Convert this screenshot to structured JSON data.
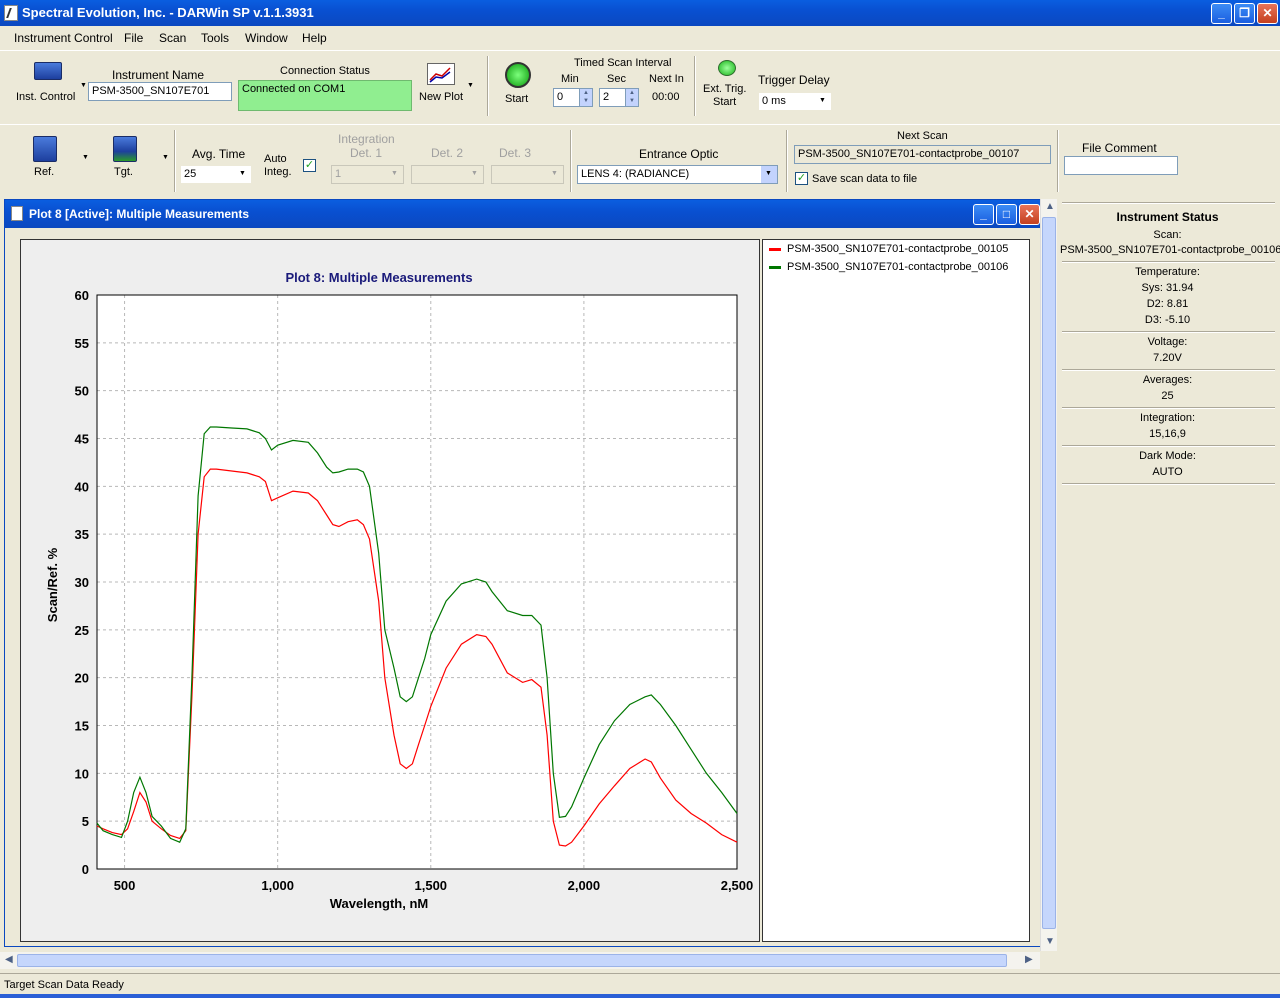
{
  "window": {
    "title": "Spectral Evolution, Inc. - DARWin SP v.1.1.3931"
  },
  "menu": [
    "Instrument Control",
    "File",
    "Scan",
    "Tools",
    "Window",
    "Help"
  ],
  "toolbar1": {
    "inst_control_label": "Inst. Control",
    "instrument_name_label": "Instrument Name",
    "instrument_name_value": "PSM-3500_SN107E701",
    "connection_status_label": "Connection Status",
    "connection_status_value": "Connected on COM1",
    "new_plot_label": "New Plot",
    "start_label": "Start",
    "timed_scan_label": "Timed Scan Interval",
    "min_label": "Min",
    "sec_label": "Sec",
    "next_in_label": "Next In",
    "min_value": "0",
    "sec_value": "2",
    "next_in_value": "00:00",
    "ext_trig_label": "Ext. Trig.",
    "ext_trig_start_label": "Start",
    "trigger_delay_label": "Trigger Delay",
    "trigger_delay_value": "0 ms"
  },
  "toolbar2": {
    "ref_label": "Ref.",
    "tgt_label": "Tgt.",
    "avg_time_label": "Avg. Time",
    "avg_time_value": "25",
    "auto_integ_label_1": "Auto",
    "auto_integ_label_2": "Integ.",
    "integration_label": "Integration",
    "det1_label": "Det. 1",
    "det1_value": "1",
    "det2_label": "Det. 2",
    "det3_label": "Det. 3",
    "entrance_optic_label": "Entrance Optic",
    "entrance_optic_value": "LENS 4: (RADIANCE)",
    "next_scan_label": "Next Scan",
    "next_scan_value": "PSM-3500_SN107E701-contactprobe_00107",
    "save_scan_label": "Save scan data to file",
    "file_comment_label": "File Comment",
    "file_comment_value": ""
  },
  "plot_window": {
    "title": "Plot 8 [Active]: Multiple Measurements"
  },
  "legend": [
    {
      "name": "PSM-3500_SN107E701-contactprobe_00105",
      "color": "#ff0000"
    },
    {
      "name": "PSM-3500_SN107E701-contactprobe_00106",
      "color": "#007700"
    }
  ],
  "chart_data": {
    "type": "line",
    "title": "Plot 8: Multiple Measurements",
    "xlabel": "Wavelength, nM",
    "ylabel": "Scan/Ref. %",
    "xlim": [
      410,
      2500
    ],
    "ylim": [
      0,
      60
    ],
    "x_ticks": [
      500,
      1000,
      1500,
      2000,
      2500
    ],
    "x_tick_labels": [
      "500",
      "1,000",
      "1,500",
      "2,000",
      "2,500"
    ],
    "y_ticks": [
      0,
      5,
      10,
      15,
      20,
      25,
      30,
      35,
      40,
      45,
      50,
      55,
      60
    ],
    "grid": true,
    "series": [
      {
        "name": "PSM-3500_SN107E701-contactprobe_00105",
        "color": "#ff0000",
        "x": [
          410,
          430,
          460,
          490,
          510,
          530,
          550,
          570,
          590,
          620,
          650,
          680,
          700,
          720,
          740,
          760,
          780,
          800,
          850,
          900,
          940,
          960,
          980,
          1000,
          1050,
          1100,
          1130,
          1160,
          1180,
          1200,
          1230,
          1260,
          1280,
          1300,
          1330,
          1350,
          1380,
          1400,
          1420,
          1440,
          1460,
          1480,
          1500,
          1550,
          1600,
          1650,
          1680,
          1700,
          1750,
          1800,
          1830,
          1860,
          1880,
          1900,
          1920,
          1940,
          1960,
          2000,
          2050,
          2100,
          2150,
          2200,
          2220,
          2250,
          2300,
          2350,
          2400,
          2450,
          2500
        ],
        "y": [
          4.5,
          4.2,
          3.8,
          3.6,
          4.2,
          6.0,
          8.0,
          7.0,
          5.0,
          4.2,
          3.5,
          3.2,
          4.0,
          18,
          35,
          41,
          41.8,
          41.8,
          41.6,
          41.4,
          41.0,
          40.5,
          38.5,
          38.8,
          39.5,
          39.3,
          38.5,
          37.0,
          36.0,
          35.8,
          36.3,
          36.5,
          36.0,
          34.5,
          28.0,
          20.0,
          14.0,
          11.0,
          10.5,
          11.0,
          13.0,
          15.0,
          17.0,
          21.0,
          23.5,
          24.5,
          24.3,
          23.5,
          20.5,
          19.5,
          19.8,
          19.0,
          14.0,
          5.0,
          2.5,
          2.4,
          2.8,
          4.5,
          6.8,
          8.7,
          10.5,
          11.5,
          11.2,
          9.5,
          7.2,
          5.8,
          4.8,
          3.6,
          2.8
        ]
      },
      {
        "name": "PSM-3500_SN107E701-contactprobe_00106",
        "color": "#007700",
        "x": [
          410,
          430,
          460,
          490,
          510,
          530,
          550,
          570,
          590,
          620,
          650,
          680,
          700,
          720,
          740,
          760,
          780,
          800,
          850,
          900,
          940,
          960,
          980,
          1000,
          1050,
          1100,
          1130,
          1160,
          1180,
          1200,
          1230,
          1260,
          1280,
          1300,
          1330,
          1350,
          1380,
          1400,
          1420,
          1440,
          1460,
          1480,
          1500,
          1550,
          1600,
          1650,
          1680,
          1700,
          1750,
          1800,
          1830,
          1860,
          1880,
          1900,
          1920,
          1940,
          1960,
          2000,
          2050,
          2100,
          2150,
          2200,
          2220,
          2250,
          2300,
          2350,
          2400,
          2450,
          2500
        ],
        "y": [
          4.8,
          4.0,
          3.6,
          3.3,
          5.0,
          8.0,
          9.6,
          8.0,
          5.5,
          4.5,
          3.2,
          2.8,
          4.2,
          20,
          39,
          45.5,
          46.2,
          46.2,
          46.1,
          46.0,
          45.6,
          45.0,
          43.8,
          44.3,
          44.8,
          44.6,
          43.5,
          42.0,
          41.4,
          41.5,
          41.8,
          41.8,
          41.5,
          40.0,
          33.0,
          25.0,
          21.0,
          18.0,
          17.5,
          18.0,
          20.0,
          22.0,
          24.5,
          28.0,
          29.8,
          30.3,
          30.0,
          29.0,
          27.0,
          26.5,
          26.5,
          25.5,
          20.0,
          10.0,
          5.4,
          5.5,
          6.5,
          9.5,
          13.0,
          15.5,
          17.2,
          18.0,
          18.2,
          17.2,
          15.0,
          12.5,
          10.0,
          8.0,
          5.8
        ]
      }
    ]
  },
  "instrument_status": {
    "title": "Instrument Status",
    "scan_label": "Scan:",
    "scan_value": "PSM-3500_SN107E701-contactprobe_00106",
    "temperature_label": "Temperature:",
    "sys": "Sys: 31.94",
    "d2": "D2: 8.81",
    "d3": "D3: -5.10",
    "voltage_label": "Voltage:",
    "voltage_value": "7.20V",
    "averages_label": "Averages:",
    "averages_value": "25",
    "integration_label": "Integration:",
    "integration_value": "15,16,9",
    "dark_mode_label": "Dark Mode:",
    "dark_mode_value": "AUTO"
  },
  "statusbar": {
    "text": "Target Scan Data Ready"
  }
}
